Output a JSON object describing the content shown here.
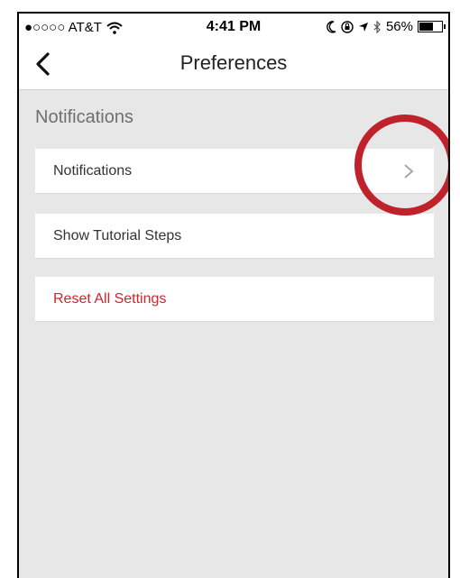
{
  "status_bar": {
    "carrier": "●○○○○ AT&T",
    "time": "4:41 PM",
    "battery_percent": "56%",
    "battery_level": 0.56
  },
  "nav": {
    "title": "Preferences"
  },
  "section": {
    "header": "Notifications"
  },
  "rows": [
    {
      "label": "Notifications"
    },
    {
      "label": "Show Tutorial Steps"
    },
    {
      "label": "Reset All Settings"
    }
  ],
  "colors": {
    "accent_red": "#d4232b",
    "background": "#e7e7e7",
    "annotation": "#c0222c"
  },
  "icons": [
    "back-chevron-icon",
    "wifi-icon",
    "moon-icon",
    "lock-rotation-icon",
    "location-icon",
    "bluetooth-icon",
    "battery-icon",
    "chevron-right-icon"
  ]
}
